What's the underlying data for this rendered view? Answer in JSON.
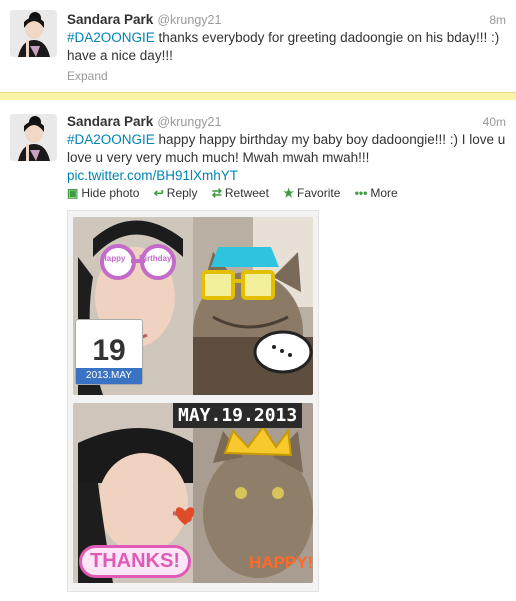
{
  "tweets": [
    {
      "name": "Sandara Park",
      "handle": "@krungy21",
      "time": "8m",
      "hashtag": "#DA2OONGIE",
      "text": " thanks everybody for greeting dadoongie on his bday!!! :) have a nice day!!!",
      "expand": "Expand"
    },
    {
      "name": "Sandara Park",
      "handle": "@krungy21",
      "time": "40m",
      "hashtag": "#DA2OONGIE",
      "text": " happy happy birthday my baby boy dadoongie!!! :) I love u love u very very much much! Mwah mwah mwah!!!",
      "link": "pic.twitter.com/BH91lXmhYT",
      "actions": {
        "hide_photo": "Hide photo",
        "reply": "Reply",
        "retweet": "Retweet",
        "favorite": "Favorite",
        "more": "More"
      },
      "photo": {
        "calendar_day": "19",
        "calendar_label": "2013.MAY",
        "date_banner": "MAY.19.2013",
        "thanks": "THANKS!",
        "happy": "HAPPY!",
        "glasses_text_left": "Happy",
        "glasses_text_right": "Birthday"
      }
    }
  ],
  "icons": [
    "avatar",
    "expand-icon",
    "reply-icon",
    "retweet-icon",
    "favorite-star-icon",
    "more-dots-icon",
    "photo-icon"
  ],
  "colors": {
    "link": "#0084b4",
    "divider": "#fbf3a7",
    "action": "#3f9b3f"
  }
}
